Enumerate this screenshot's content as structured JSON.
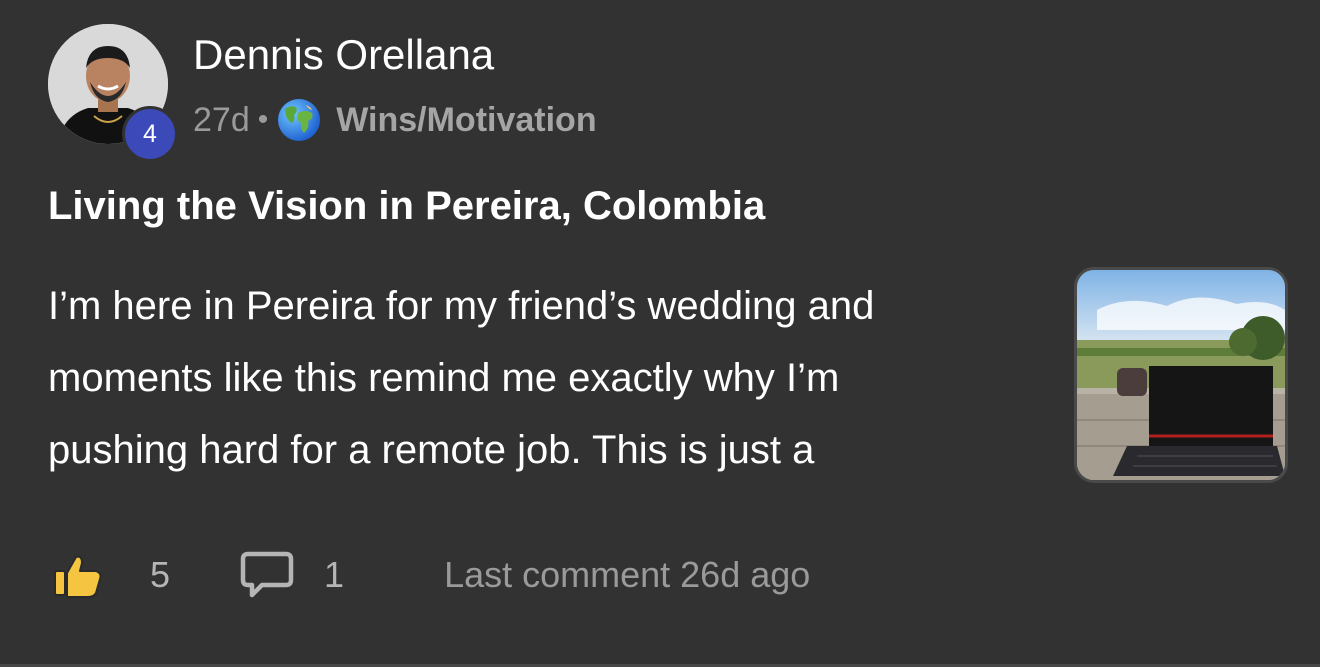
{
  "author": {
    "name": "Dennis Orellana",
    "level": "4"
  },
  "meta": {
    "age": "27d",
    "separator": "•",
    "category": "Wins/Motivation",
    "category_icon": "globe-icon"
  },
  "post": {
    "title": "Living the Vision in Pereira, Colombia",
    "body_lines": [
      "I’m here in Pereira for my friend’s wedding and",
      "moments like this remind me exactly why I’m",
      "pushing hard for a remote job. This is just a"
    ]
  },
  "footer": {
    "like_icon": "thumbs-up-icon",
    "like_count": "5",
    "comment_icon": "comment-bubble-icon",
    "comment_count": "1",
    "last_comment": "Last comment 26d ago"
  },
  "colors": {
    "background": "#323232",
    "text_primary": "#ffffff",
    "text_secondary": "#9a9a9a",
    "level_badge": "#3b4ab8",
    "like_icon": "#f5c542"
  }
}
